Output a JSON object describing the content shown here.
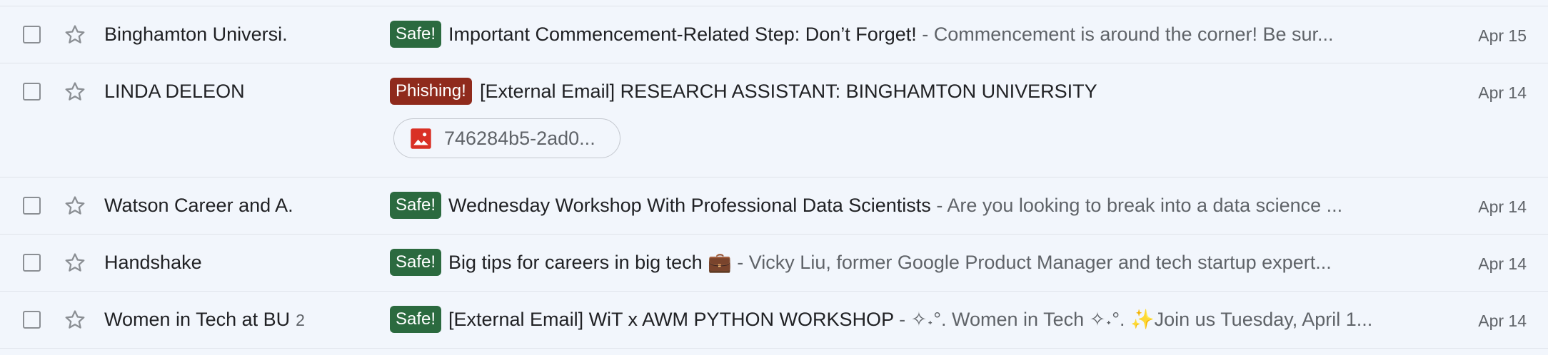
{
  "colors": {
    "safe_badge": "#2b6a3f",
    "phishing_badge": "#8f2a1c",
    "background": "#f2f6fc",
    "attachment_icon": "#d93025"
  },
  "emails": [
    {
      "sender": "Binghamton Universi.",
      "count": "",
      "badge": "Safe!",
      "subject": "Important Commencement-Related Step: Don’t Forget!",
      "snippet": " - Commencement is around the corner! Be sur...",
      "date": "Apr 15"
    },
    {
      "sender": "LINDA DELEON",
      "count": "",
      "badge": "Phishing!",
      "subject": "[External Email] RESEARCH ASSISTANT: BINGHAMTON UNIVERSITY",
      "snippet": "",
      "date": "Apr 14",
      "attachment": {
        "name": "746284b5-2ad0...",
        "icon": "image-icon"
      }
    },
    {
      "sender": "Watson Career and A.",
      "count": "",
      "badge": "Safe!",
      "subject": "Wednesday Workshop With Professional Data Scientists",
      "snippet": " - Are you looking to break into a data science ...",
      "date": "Apr 14"
    },
    {
      "sender": "Handshake",
      "count": "",
      "badge": "Safe!",
      "subject": "Big tips for careers in big tech 💼",
      "snippet": " - Vicky Liu, former Google Product Manager and tech startup expert...",
      "date": "Apr 14"
    },
    {
      "sender": "Women in Tech at BU",
      "count": "2",
      "badge": "Safe!",
      "subject": "[External Email] WiT x AWM PYTHON WORKSHOP",
      "snippet": " - ✧˖°. Women in Tech ✧˖°. ✨Join us Tuesday, April 1...",
      "date": "Apr 14"
    }
  ]
}
